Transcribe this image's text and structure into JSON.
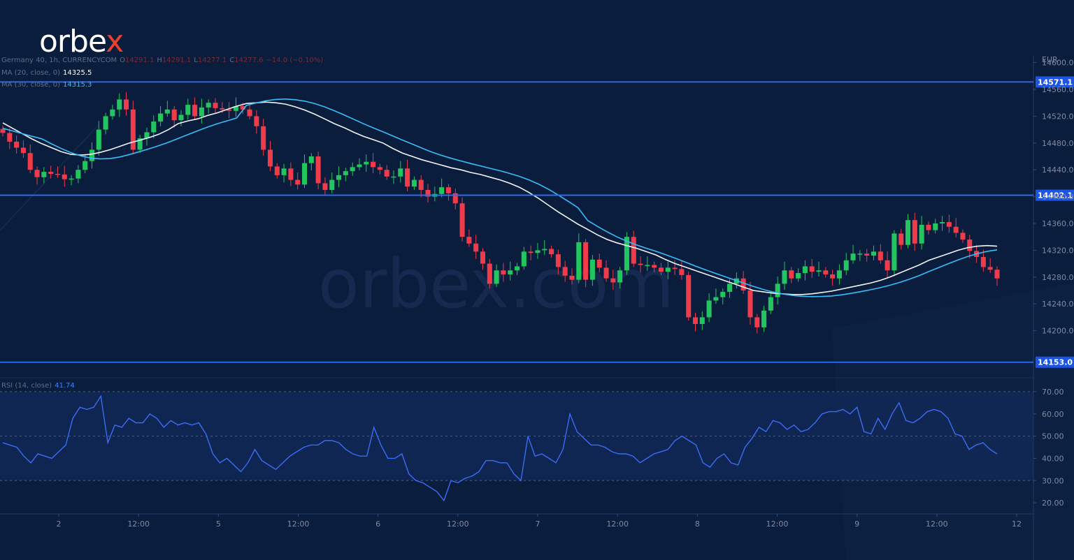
{
  "brand": {
    "logo_main": "orbe",
    "logo_x": "x",
    "watermark": "orbex.com"
  },
  "legend": {
    "symbol": "Germany 40, 1h, CURRENCYCOM",
    "o_label": "O",
    "o": "14291.1",
    "h_label": "H",
    "h": "14291.1",
    "l_label": "L",
    "l": "14277.1",
    "c_label": "C",
    "c": "14277.6",
    "chg": "−14.0 (−0.10%)",
    "ma20_label": "MA (20, close, 0)",
    "ma20": "14325.5",
    "ma30_label": "MA (30, close, 0)",
    "ma30": "14315.3",
    "rsi_label": "RSI (14, close)",
    "rsi": "41.74"
  },
  "colors": {
    "background": "#0b1d3d",
    "bull": "#22c55e",
    "bear": "#ef3b4a",
    "ma20": "#f2f4f8",
    "ma30": "#38bdf8",
    "hline": "#2b6dff",
    "rsi": "#3b6cf5"
  },
  "chart_data": [
    {
      "type": "candlestick",
      "currency": "EUR",
      "ylim": [
        14135,
        14610
      ],
      "yticks": [
        "14600.0",
        "14560.0",
        "14520.0",
        "14480.0",
        "14440.0",
        "14400.0",
        "14360.0",
        "14320.0",
        "14280.0",
        "14240.0",
        "14200.0"
      ],
      "x_ticks": [
        "2",
        "12:00",
        "5",
        "12:00",
        "6",
        "12:00",
        "7",
        "12:00",
        "8",
        "12:00",
        "9",
        "12:00",
        "12"
      ],
      "hlines": [
        "14571.1",
        "14402.1",
        "14153.0"
      ],
      "closes": [
        14495,
        14482,
        14473,
        14465,
        14440,
        14429,
        14437,
        14434,
        14433,
        14426,
        14427,
        14440,
        14453,
        14470,
        14500,
        14520,
        14530,
        14545,
        14530,
        14470,
        14487,
        14496,
        14512,
        14524,
        14530,
        14514,
        14522,
        14537,
        14520,
        14533,
        14540,
        14532,
        14530,
        14528,
        14535,
        14530,
        14520,
        14505,
        14470,
        14445,
        14432,
        14442,
        14425,
        14418,
        14450,
        14460,
        14420,
        14410,
        14425,
        14432,
        14438,
        14444,
        14448,
        14452,
        14444,
        14440,
        14430,
        14430,
        14442,
        14415,
        14425,
        14410,
        14400,
        14404,
        14414,
        14405,
        14390,
        14340,
        14330,
        14318,
        14300,
        14270,
        14290,
        14284,
        14290,
        14296,
        14318,
        14316,
        14320,
        14322,
        14314,
        14295,
        14282,
        14276,
        14332,
        14276,
        14306,
        14294,
        14278,
        14272,
        14290,
        14340,
        14300,
        14298,
        14298,
        14294,
        14288,
        14294,
        14292,
        14283,
        14220,
        14210,
        14220,
        14245,
        14250,
        14258,
        14270,
        14278,
        14260,
        14220,
        14205,
        14230,
        14250,
        14270,
        14290,
        14278,
        14286,
        14296,
        14288,
        14290,
        14284,
        14278,
        14290,
        14305,
        14315,
        14315,
        14312,
        14318,
        14305,
        14290,
        14345,
        14328,
        14365,
        14330,
        14358,
        14350,
        14360,
        14362,
        14355,
        14346,
        14336,
        14319,
        14310,
        14295,
        14291,
        14278
      ],
      "ma20": [
        14510,
        14502,
        14494,
        14486,
        14479,
        14473,
        14467,
        14463,
        14462,
        14463,
        14466,
        14470,
        14475,
        14480,
        14484,
        14488,
        14493,
        14500,
        14509,
        14513,
        14516,
        14521,
        14525,
        14530,
        14535,
        14539,
        14540,
        14541,
        14540,
        14538,
        14534,
        14529,
        14523,
        14516,
        14509,
        14503,
        14496,
        14490,
        14485,
        14480,
        14472,
        14465,
        14460,
        14455,
        14451,
        14447,
        14443,
        14440,
        14436,
        14433,
        14429,
        14425,
        14420,
        14414,
        14406,
        14397,
        14387,
        14377,
        14368,
        14359,
        14351,
        14343,
        14336,
        14331,
        14327,
        14323,
        14318,
        14313,
        14306,
        14300,
        14295,
        14290,
        14285,
        14280,
        14275,
        14270,
        14265,
        14260,
        14258,
        14256,
        14255,
        14254,
        14254,
        14255,
        14257,
        14259,
        14262,
        14265,
        14268,
        14271,
        14275,
        14280,
        14286,
        14292,
        14298,
        14305,
        14310,
        14315,
        14320,
        14324,
        14326,
        14327,
        14326
      ]
    },
    {
      "type": "line",
      "title": "RSI (14, close)",
      "ylim": [
        15,
        75
      ],
      "yticks": [
        "70.00",
        "60.00",
        "50.00",
        "40.00",
        "30.00",
        "20.00"
      ],
      "overbought": 70,
      "midline": 50,
      "oversold": 30,
      "values": [
        47,
        46,
        45,
        41,
        38,
        42,
        41,
        40,
        43,
        46,
        58,
        63,
        62,
        63,
        68,
        47,
        55,
        54,
        58,
        56,
        56,
        60,
        58,
        54,
        57,
        55,
        56,
        55,
        56,
        51,
        42,
        38,
        40,
        37,
        34,
        38,
        44,
        39,
        37,
        35,
        38,
        41,
        43,
        45,
        46,
        46,
        48,
        48,
        47,
        44,
        42,
        41,
        41,
        54,
        46,
        40,
        40,
        42,
        33,
        30,
        29,
        27,
        25,
        21,
        30,
        29,
        31,
        32,
        34,
        39,
        39,
        38,
        38,
        33,
        30,
        50,
        41,
        42,
        40,
        38,
        44,
        60,
        52,
        49,
        46,
        46,
        45,
        43,
        42,
        42,
        41,
        38,
        40,
        42,
        43,
        44,
        48,
        50,
        48,
        46,
        38,
        36,
        40,
        42,
        38,
        37,
        45,
        49,
        54,
        52,
        57,
        56,
        53,
        55,
        52,
        53,
        56,
        60,
        61,
        61,
        62,
        60,
        63,
        52,
        51,
        58,
        53,
        60,
        65,
        57,
        56,
        58,
        61,
        62,
        61,
        58,
        51,
        50,
        44,
        46,
        47,
        44,
        42
      ]
    }
  ]
}
